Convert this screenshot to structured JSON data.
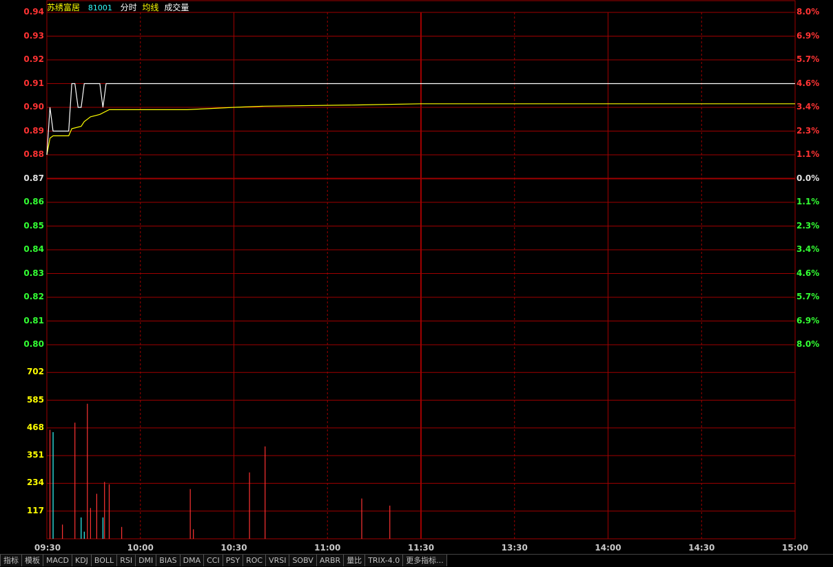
{
  "header": {
    "stock_name": "苏绣富居",
    "stock_code": "81001",
    "mode_label": "分时",
    "avg_label": "均线",
    "volume_label": "成交量"
  },
  "colors": {
    "up": "#ff3333",
    "down": "#33ff33",
    "flat": "#e0e0e0",
    "grid": "#a00000",
    "price_line": "#ffffff",
    "avg_line": "#ffff00",
    "volume_up": "#ff3333",
    "volume_down": "#33ffff",
    "volume_label": "#ffff00"
  },
  "price_axis": {
    "ticks": [
      "0.94",
      "0.93",
      "0.92",
      "0.91",
      "0.90",
      "0.89",
      "0.88",
      "0.87",
      "0.86",
      "0.85",
      "0.84",
      "0.83",
      "0.82",
      "0.81",
      "0.80"
    ],
    "pct_ticks": [
      "8.0%",
      "6.9%",
      "5.7%",
      "4.6%",
      "3.4%",
      "2.3%",
      "1.1%",
      "0.0%",
      "1.1%",
      "2.3%",
      "3.4%",
      "4.6%",
      "5.7%",
      "6.9%",
      "8.0%"
    ],
    "prev_close": 0.87
  },
  "volume_axis": {
    "ticks": [
      "702",
      "585",
      "468",
      "351",
      "234",
      "117"
    ],
    "max": 819
  },
  "time_axis": {
    "labels": [
      "09:30",
      "10:00",
      "10:30",
      "11:00",
      "11:30",
      "13:30",
      "14:00",
      "14:30",
      "15:00"
    ]
  },
  "chart_data": {
    "type": "line",
    "xlabel": "",
    "ylabel": "",
    "ylim": [
      0.8,
      0.94
    ],
    "x_minutes_range": [
      0,
      240
    ],
    "series": [
      {
        "name": "分时",
        "x": [
          0,
          1,
          2,
          3,
          4,
          5,
          6,
          7,
          8,
          9,
          10,
          11,
          12,
          13,
          14,
          15,
          16,
          17,
          18,
          19,
          20,
          240
        ],
        "values": [
          0.88,
          0.9,
          0.89,
          0.89,
          0.89,
          0.89,
          0.89,
          0.89,
          0.91,
          0.91,
          0.9,
          0.9,
          0.91,
          0.91,
          0.91,
          0.91,
          0.91,
          0.91,
          0.9,
          0.91,
          0.91,
          0.91
        ]
      },
      {
        "name": "均线",
        "x": [
          0,
          1,
          2,
          7,
          8,
          11,
          12,
          14,
          17,
          20,
          30,
          45,
          60,
          70,
          100,
          120,
          240
        ],
        "values": [
          0.88,
          0.887,
          0.888,
          0.888,
          0.891,
          0.892,
          0.894,
          0.896,
          0.897,
          0.899,
          0.899,
          0.899,
          0.9,
          0.9005,
          0.901,
          0.9015,
          0.9015
        ]
      }
    ],
    "volume": {
      "x": [
        1,
        2,
        5,
        9,
        11,
        12,
        13,
        14,
        16,
        18,
        18.5,
        20,
        24,
        46,
        47,
        65,
        70,
        101,
        110
      ],
      "values": [
        460,
        450,
        60,
        490,
        90,
        30,
        570,
        130,
        190,
        90,
        240,
        230,
        50,
        210,
        40,
        280,
        390,
        170,
        140
      ],
      "direction": [
        "up",
        "down",
        "up",
        "up",
        "down",
        "down",
        "up",
        "up",
        "up",
        "down",
        "up",
        "up",
        "up",
        "up",
        "up",
        "up",
        "up",
        "up",
        "up"
      ]
    }
  },
  "tabs": [
    "指标",
    "模板",
    "MACD",
    "KDJ",
    "BOLL",
    "RSI",
    "DMI",
    "BIAS",
    "DMA",
    "CCI",
    "PSY",
    "ROC",
    "VRSI",
    "SOBV",
    "ARBR",
    "量比",
    "TRIX-4.0",
    "更多指标..."
  ]
}
